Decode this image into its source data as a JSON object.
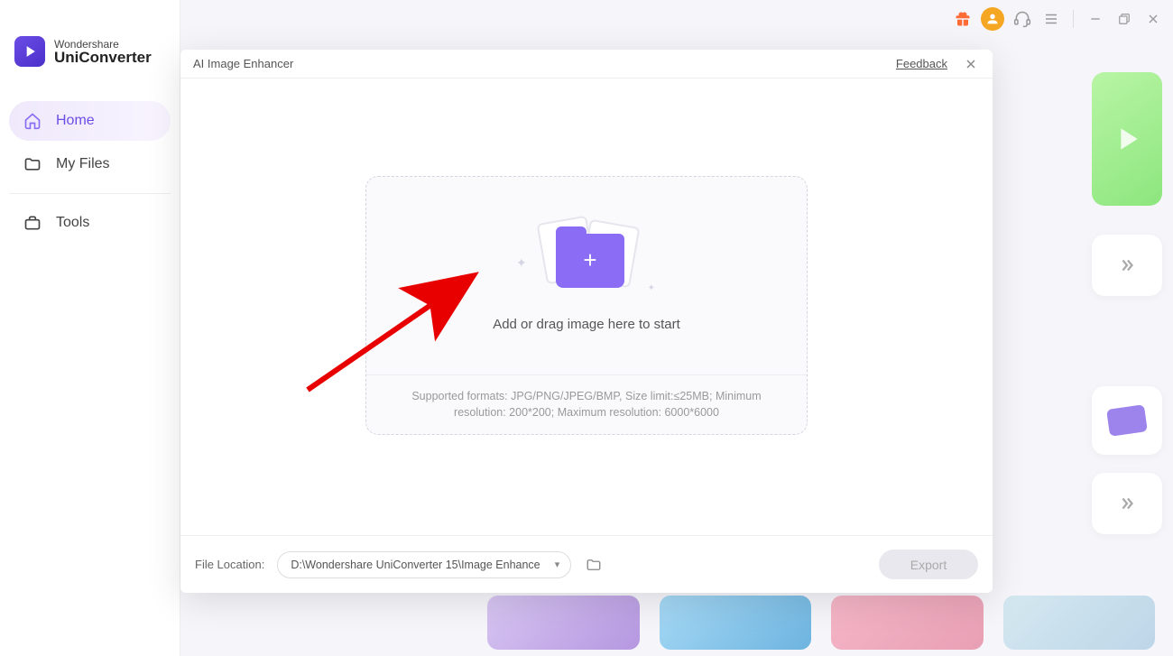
{
  "brand": {
    "top": "Wondershare",
    "bottom": "UniConverter"
  },
  "nav": {
    "home": "Home",
    "myfiles": "My Files",
    "tools": "Tools"
  },
  "dialog": {
    "title": "AI Image Enhancer",
    "feedback": "Feedback",
    "dropzone_text": "Add or drag image here to start",
    "formats_info": "Supported formats: JPG/PNG/JPEG/BMP, Size limit:≤25MB; Minimum resolution: 200*200; Maximum resolution: 6000*6000",
    "file_location_label": "File Location:",
    "file_path": "D:\\Wondershare UniConverter 15\\Image Enhance",
    "export": "Export"
  }
}
